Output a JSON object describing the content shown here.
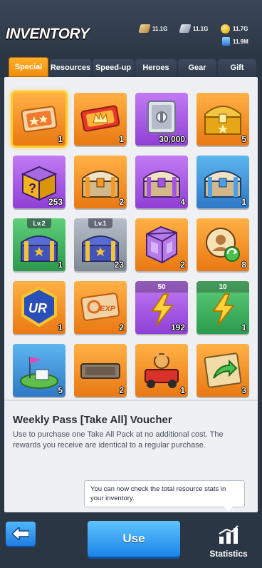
{
  "header": {
    "title": "INVENTORY",
    "resources": [
      {
        "name": "wood",
        "icon": "wood-icon",
        "value": "11.1G"
      },
      {
        "name": "iron",
        "icon": "iron-icon",
        "value": "11.1G"
      },
      {
        "name": "gold",
        "icon": "gold-coin-icon",
        "value": "11.7G"
      },
      {
        "name": "oil",
        "icon": "oil-icon",
        "value": "11.9M"
      }
    ]
  },
  "tabs": [
    {
      "label": "Special",
      "active": true
    },
    {
      "label": "Resources",
      "active": false
    },
    {
      "label": "Speed-up",
      "active": false
    },
    {
      "label": "Heroes",
      "active": false
    },
    {
      "label": "Gear",
      "active": false
    },
    {
      "label": "Gift",
      "active": false
    }
  ],
  "items": [
    {
      "name": "weekly-pass-voucher",
      "icon": "ticket-voucher-icon",
      "count": "1",
      "bg": "orange",
      "selected": true
    },
    {
      "name": "crown-ticket",
      "icon": "ticket-icon",
      "count": "1",
      "bg": "orange"
    },
    {
      "name": "silver-safe",
      "icon": "safe-icon",
      "count": "30,000",
      "bg": "purple"
    },
    {
      "name": "gold-chest",
      "icon": "chest-icon",
      "count": "5",
      "bg": "orange"
    },
    {
      "name": "mystery-box",
      "icon": "question-box-icon",
      "count": "253",
      "bg": "purple"
    },
    {
      "name": "orange-chest",
      "icon": "chest-icon",
      "count": "2",
      "bg": "orange"
    },
    {
      "name": "purple-chest",
      "icon": "chest-icon",
      "count": "4",
      "bg": "purple"
    },
    {
      "name": "blue-chest",
      "icon": "chest-icon",
      "count": "1",
      "bg": "blue"
    },
    {
      "name": "level-2-chest",
      "icon": "chest-icon",
      "count": "1",
      "bg": "green",
      "level": "Lv.2"
    },
    {
      "name": "level-1-chest",
      "icon": "chest-icon",
      "count": "23",
      "bg": "gray",
      "level": "Lv.1"
    },
    {
      "name": "purple-crate",
      "icon": "crate-icon",
      "count": "2",
      "bg": "orange"
    },
    {
      "name": "hero-swap",
      "icon": "hero-swap-icon",
      "count": "8",
      "bg": "orange"
    },
    {
      "name": "ur-badge",
      "icon": "ur-badge-icon",
      "count": "1",
      "bg": "orange"
    },
    {
      "name": "exp-ticket",
      "icon": "exp-ticket-icon",
      "count": "2",
      "bg": "orange"
    },
    {
      "name": "energy-50",
      "icon": "lightning-icon",
      "count": "192",
      "bg": "purple",
      "top": "50"
    },
    {
      "name": "energy-10",
      "icon": "lightning-icon",
      "count": "1",
      "bg": "green",
      "top": "10"
    },
    {
      "name": "base-flag",
      "icon": "flag-island-icon",
      "count": "5",
      "bg": "blue"
    },
    {
      "name": "nameplate",
      "icon": "nameplate-icon",
      "count": "2",
      "bg": "orange"
    },
    {
      "name": "dog-vehicle",
      "icon": "vehicle-icon",
      "count": "1",
      "bg": "orange"
    },
    {
      "name": "map-card",
      "icon": "map-arrow-icon",
      "count": "3",
      "bg": "orange"
    }
  ],
  "detail": {
    "title": "Weekly Pass [Take All] Voucher",
    "description": "Use to purchase one Take All Pack at no additional cost. The rewards you receive are identical to a regular purchase."
  },
  "tooltip": {
    "text": "You can now check the total resource stats in your inventory."
  },
  "footer": {
    "use_label": "Use",
    "statistics_label": "Statistics"
  },
  "colors": {
    "accent": "#f28a0c",
    "button_blue": "#1c84e8"
  }
}
